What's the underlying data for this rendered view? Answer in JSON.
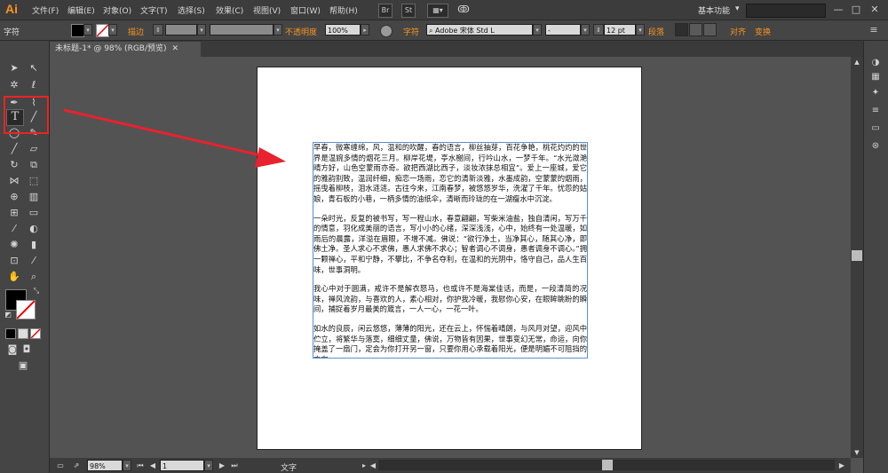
{
  "app": {
    "logo": "Ai",
    "workspace": "基本功能"
  },
  "menu": [
    "文件(F)",
    "编辑(E)",
    "对象(O)",
    "文字(T)",
    "选择(S)",
    "效果(C)",
    "视图(V)",
    "窗口(W)",
    "帮助(H)"
  ],
  "menubar_icons": {
    "bridge": "Br",
    "stock": "St"
  },
  "controlbar": {
    "tool_name": "字符",
    "stroke_label": "描边",
    "opacity_label": "不透明度",
    "opacity_value": "100%",
    "char_label": "字符",
    "font_value": "Adobe 宋体 Std L",
    "font_style_value": "-",
    "font_size_value": "12 pt",
    "paragraph_label": "段落",
    "align_label": "对齐",
    "transform_label": "变换"
  },
  "document": {
    "tab_title": "未标题-1* @ 98% (RGB/预览)"
  },
  "status": {
    "zoom": "98%",
    "artboard": "1",
    "tool": "文字"
  },
  "text_frame": {
    "paragraphs": [
      "早春，微寒缠绵，风，温和的吹醒，春的语言，柳丝抽芽，百花争艳，桃花灼灼的世界是温婉多情的烟花三月。柳岸花堤，亭水榭间，行吟山水，一梦千年。“水光潋滟晴方好，山色空蒙雨亦奇。欲把西湖比西子，淡妆浓抹总相宜”。爱上一座城，爱它的雅韵别致，温润纤细，痴恋一场雨，恋它的清新淡雅，水墨成韵，空蒙蒙的烟雨，摇曳着柳枝，泪水涟涟。古往今来，江南春梦，被悠悠岁华，洗濯了千年。忧怨的姑娘，青石板的小巷，一柄多情的油纸伞，清晰而玲珑的在一湖瘦水中沉淀。",
      "一朵时光，反复的被书写，写一程山水，春意翩翩，写柴米油盐，独自清闲，写万千的情意，羽化成美丽的语言，写小小的心绪，深深浅浅，心中，始终有一处温暖，如雨后的晨露，洋溢在眉眼，不增不减。佛说：“欲行净土，当净其心，随其心净，即佛土净。圣人求心不求佛，愚人求佛不求心；智者调心不调身，愚者调身不调心。”拥一颗禅心，平和宁静，不攀比，不争名夺利，在温和的光阴中，恪守自己，品人生百味，世事洞明。",
      "我心中对于圆满，戒许不是解衣怒马，也或许不是海棠佳话，而是，一段清简的况味，禅风流韵，与喜欢的人，素心相对，你护我冷暖，我慰你心安，在眼眸眺盼的瞬间，捕捉着岁月最美的箴言，一人一心，一花一叶。",
      "如水的良辰，闲云悠悠，薄薄的阳光，还在云上，怀惴着晴朗，与风月对望，迎风中伫立，将繁华与落寞，细细丈量，佛说，万物皆有因果，世事变幻无常，命运，向你掩盖了一扇门，定会为你打开另一窗，只要你用心承载着阳光，便是明媚不可阻挡的方向。"
    ]
  },
  "colors": {
    "highlight": "#e22222",
    "arrow": "#e8222e",
    "selection": "#5b8fd6",
    "accent": "#f7931e"
  }
}
